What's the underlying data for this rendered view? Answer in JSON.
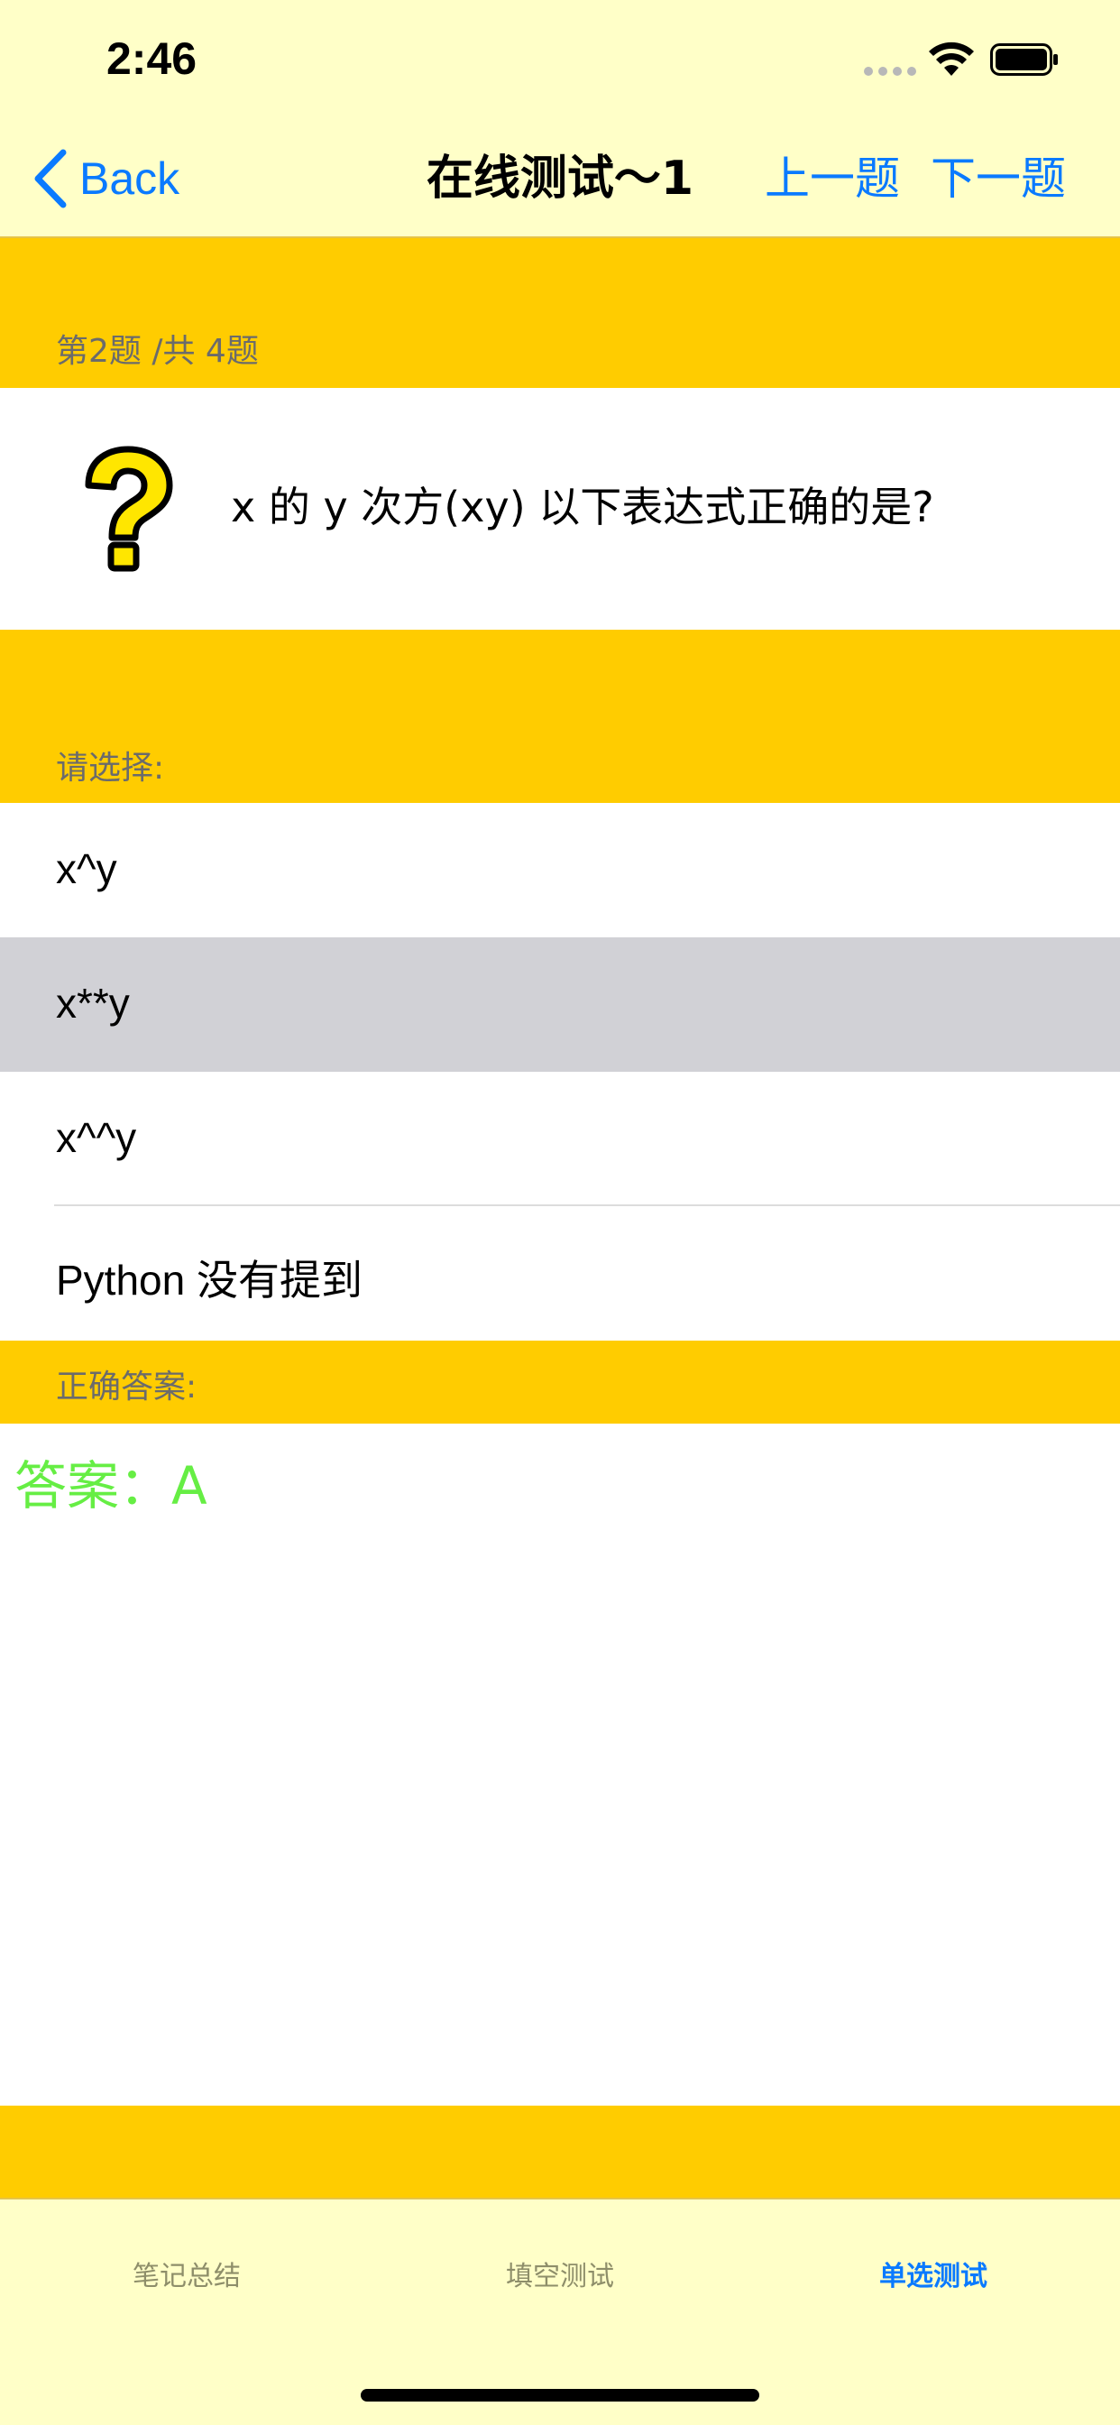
{
  "status_bar": {
    "time": "2:46",
    "icons": [
      "signal-dots-icon",
      "wifi-icon",
      "battery-icon"
    ]
  },
  "nav": {
    "back_label": "Back",
    "title": "在线测试～1",
    "prev_label": "上一题",
    "next_label": "下一题"
  },
  "question": {
    "progress_label": "第2题 /共 4题",
    "icon": "question-mark-icon",
    "text": "x 的 y 次方(xy) 以下表达式正确的是?"
  },
  "options_section": {
    "label": "请选择:",
    "options": [
      {
        "text": "x^y",
        "selected": false
      },
      {
        "text": "x**y",
        "selected": true
      },
      {
        "text": "x^^y",
        "selected": false
      },
      {
        "text": "Python 没有提到",
        "selected": false
      }
    ]
  },
  "answer_section": {
    "label": "正确答案:",
    "answer": "答案：A"
  },
  "tab_bar": {
    "tabs": [
      {
        "label": "笔记总结",
        "active": false
      },
      {
        "label": "填空测试",
        "active": false
      },
      {
        "label": "单选测试",
        "active": true
      }
    ]
  },
  "colors": {
    "band": "#FFCC00",
    "bars": "#FFFFC8",
    "accent": "#0a7aff",
    "selected_row": "#D1D1D6",
    "answer": "#66ee44"
  }
}
